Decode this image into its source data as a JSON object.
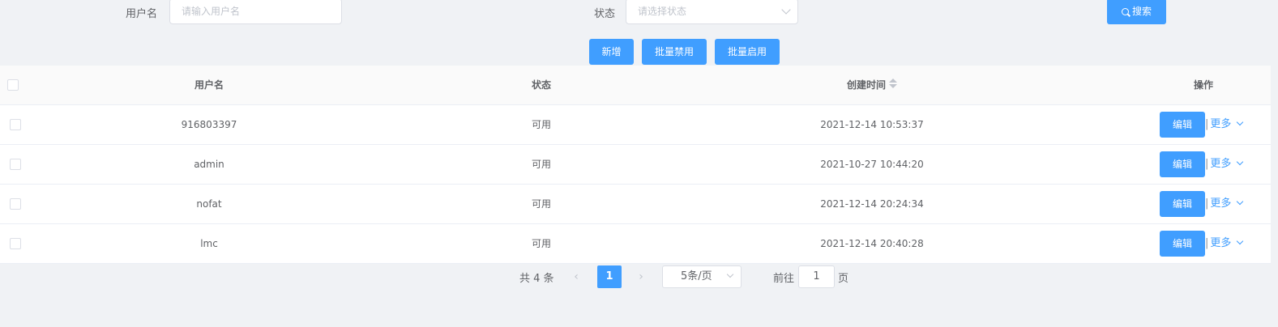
{
  "search": {
    "username_label": "用户名",
    "username_placeholder": "请输入用户名",
    "status_label": "状态",
    "status_placeholder": "请选择状态",
    "search_button": "搜索"
  },
  "toolbar": {
    "add": "新增",
    "batch_disable": "批量禁用",
    "batch_enable": "批量启用"
  },
  "table": {
    "headers": {
      "username": "用户名",
      "status": "状态",
      "created_at": "创建时间",
      "actions": "操作"
    },
    "rows": [
      {
        "username": "916803397",
        "status": "可用",
        "created_at": "2021-12-14 10:53:37",
        "edit": "编辑",
        "more": "更多"
      },
      {
        "username": "admin",
        "status": "可用",
        "created_at": "2021-10-27 10:44:20",
        "edit": "编辑",
        "more": "更多"
      },
      {
        "username": "nofat",
        "status": "可用",
        "created_at": "2021-12-14 20:24:34",
        "edit": "编辑",
        "more": "更多"
      },
      {
        "username": "lmc",
        "status": "可用",
        "created_at": "2021-12-14 20:40:28",
        "edit": "编辑",
        "more": "更多"
      }
    ]
  },
  "pagination": {
    "total": "共 4 条",
    "prev": "‹",
    "current_page": "1",
    "next": "›",
    "page_size": "5条/页",
    "goto_label": "前往",
    "goto_value": "1",
    "page_suffix": "页"
  },
  "colors": {
    "primary": "#409eff",
    "background": "#f0f2f5"
  }
}
